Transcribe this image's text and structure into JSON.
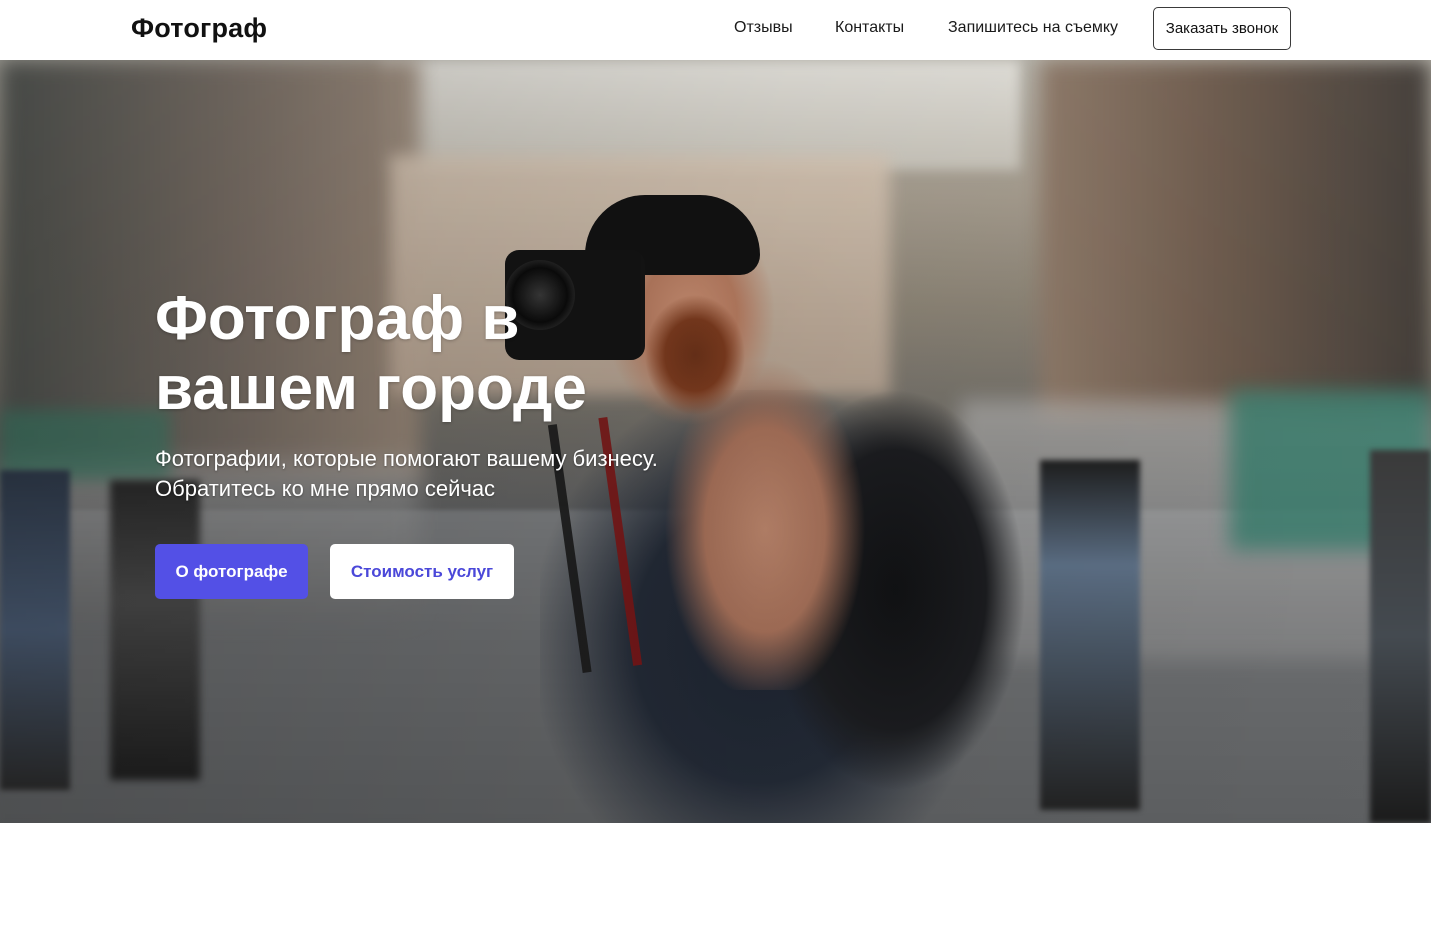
{
  "header": {
    "logo": "Фотограф",
    "nav": [
      {
        "label": "Отзывы"
      },
      {
        "label": "Контакты"
      },
      {
        "label": "Запишитесь на съемку"
      }
    ],
    "call_button": "Заказать звонок"
  },
  "hero": {
    "title": "Фотограф в вашем городе",
    "subtitle": "Фотографии, которые помогают вашему бизнесу. Обратитесь ко мне прямо сейчас",
    "buttons": {
      "about": "О фотографе",
      "pricing": "Стоимость услуг"
    }
  },
  "colors": {
    "primary": "#5350e6",
    "primary_text": "#4b48d9",
    "header_bg": "#ffffff"
  }
}
